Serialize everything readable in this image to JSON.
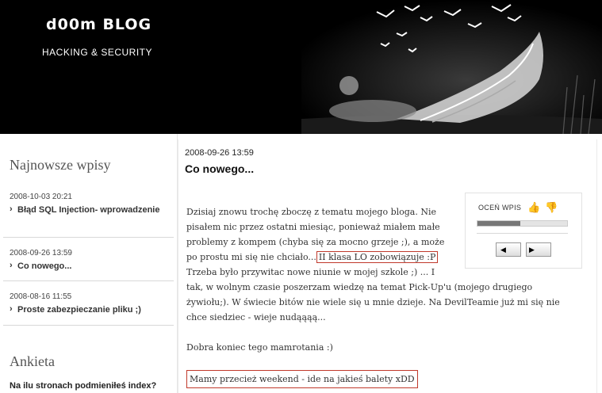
{
  "header": {
    "title": "d00m BLOG",
    "subtitle": "HACKING & SECURITY"
  },
  "sidebar": {
    "recent_heading": "Najnowsze wpisy",
    "recent_posts": [
      {
        "date": "2008-10-03 20:21",
        "title": "Błąd SQL Injection- wprowadzenie"
      },
      {
        "date": "2008-09-26 13:59",
        "title": "Co nowego..."
      },
      {
        "date": "2008-08-16 11:55",
        "title": "Proste zabezpieczanie pliku ;)"
      }
    ],
    "poll_heading": "Ankieta",
    "poll_question": "Na ilu stronach podmieniłeś index?"
  },
  "post": {
    "date": "2008-09-26 13:59",
    "title": "Co nowego...",
    "rating": {
      "label": "OCEŃ WPIS",
      "level": 0.48
    },
    "body": {
      "l1": "Dzisiaj znowu trochę zboczę z tematu mojego bloga. Nie",
      "l2": "pisałem nic przez ostatni miesiąc, ponieważ miałem małe",
      "l3": "problemy z kompem (chyba się za mocno grzeje ;), a może",
      "l4_pre": "po prostu mi się nie chciało...",
      "l4_boxed": "II klasa LO zobowiązuje :P",
      "l5": "Trzeba było przywitac nowe niunie w mojej szkole ;) ... I",
      "l6": "tak, w wolnym czasie poszerzam wiedzę na temat Pick-Up'u (mojego drugiego",
      "l7": "żywiołu;). W świecie bitów nie wiele się u mnie dzieje. Na DevilTeamie już mi się nie",
      "l8": "chce siedziec - wieje nudąąąą...",
      "p2": "Dobra koniec tego mamrotania :)",
      "p3": "Mamy przecież weekend - ide na jakieś balety xDD"
    }
  }
}
